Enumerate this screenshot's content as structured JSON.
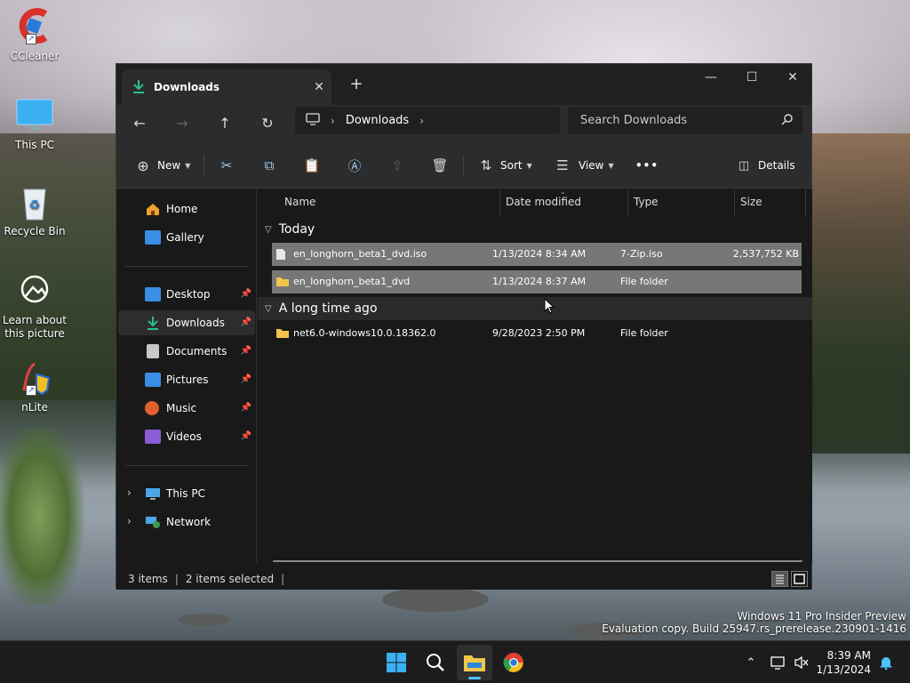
{
  "desktop": {
    "icons": [
      {
        "label": "CCleaner"
      },
      {
        "label": "This PC"
      },
      {
        "label": "Recycle Bin"
      },
      {
        "label": "Learn about this picture"
      },
      {
        "label": "nLite"
      }
    ],
    "watermark": {
      "line1": "Windows 11 Pro Insider Preview",
      "line2": "Evaluation copy. Build 25947.rs_prerelease.230901-1416"
    }
  },
  "window": {
    "tab_title": "Downloads",
    "tab_close": "✕",
    "new_tab": "+",
    "controls": {
      "minimize": "—",
      "maximize": "☐",
      "close": "✕"
    },
    "nav": {
      "back": "←",
      "forward": "→",
      "up": "↑",
      "refresh": "↻",
      "breadcrumb": [
        "Downloads"
      ],
      "search_placeholder": "Search Downloads"
    },
    "toolbar": {
      "new_label": "New",
      "sort_label": "Sort",
      "view_label": "View",
      "more_label": "•••",
      "details_label": "Details"
    },
    "sidebar": {
      "top": [
        {
          "label": "Home",
          "color": "#f0a030"
        },
        {
          "label": "Gallery",
          "color": "#3a8ee6"
        }
      ],
      "pinned": [
        {
          "label": "Desktop",
          "color": "#3a8ee6"
        },
        {
          "label": "Downloads",
          "color": "#2ebd8e"
        },
        {
          "label": "Documents",
          "color": "#c8c8c8"
        },
        {
          "label": "Pictures",
          "color": "#3a8ee6"
        },
        {
          "label": "Music",
          "color": "#e0602e"
        },
        {
          "label": "Videos",
          "color": "#8a5cd6"
        }
      ],
      "bottom": [
        {
          "label": "This PC",
          "color": "#4aa8e8"
        },
        {
          "label": "Network",
          "color": "#4aa8e8"
        }
      ],
      "expand": "›",
      "pin": "📌"
    },
    "columns": [
      "Name",
      "Date modified",
      "Type",
      "Size"
    ],
    "groups": [
      {
        "label": "Today",
        "files": [
          {
            "name": "en_longhorn_beta1_dvd.iso",
            "date": "1/13/2024 8:34 AM",
            "type": "7-Zip.iso",
            "size": "2,537,752 KB",
            "kind": "file",
            "selected": true
          },
          {
            "name": "en_longhorn_beta1_dvd",
            "date": "1/13/2024 8:37 AM",
            "type": "File folder",
            "size": "",
            "kind": "folder",
            "selected": true
          }
        ]
      },
      {
        "label": "A long time ago",
        "files": [
          {
            "name": "net6.0-windows10.0.18362.0",
            "date": "9/28/2023 2:50 PM",
            "type": "File folder",
            "size": "",
            "kind": "folder",
            "selected": false
          }
        ]
      }
    ],
    "status": {
      "items": "3 items",
      "selected": "2 items selected",
      "sep": "|"
    }
  },
  "taskbar": {
    "clock_time": "8:39 AM",
    "clock_date": "1/13/2024",
    "tray_chevron": "⌃"
  }
}
